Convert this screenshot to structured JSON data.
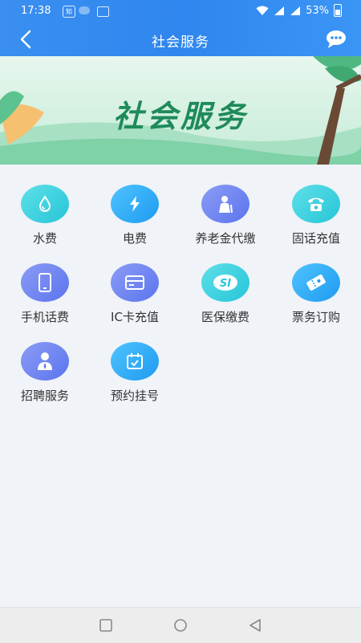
{
  "status_bar": {
    "time": "17:38",
    "notif_text": "知",
    "battery_pct": "53%"
  },
  "header": {
    "title": "社会服务",
    "back_icon": "chevron-left-icon",
    "chat_icon": "chat-bubble-icon"
  },
  "banner": {
    "title": "社会服务"
  },
  "services": [
    {
      "label": "水费",
      "icon": "water-drop-icon",
      "color": "#26c5d8"
    },
    {
      "label": "电费",
      "icon": "lightning-icon",
      "color": "#1e9bf0"
    },
    {
      "label": "养老金代缴",
      "icon": "elderly-person-icon",
      "color": "#5b74ee"
    },
    {
      "label": "固话充值",
      "icon": "telephone-icon",
      "color": "#26c5d8"
    },
    {
      "label": "手机话费",
      "icon": "mobile-phone-icon",
      "color": "#5b74ee"
    },
    {
      "label": "IC卡充值",
      "icon": "card-icon",
      "color": "#5b74ee"
    },
    {
      "label": "医保缴费",
      "icon": "insurance-badge-icon",
      "color": "#26c5d8"
    },
    {
      "label": "票务订购",
      "icon": "ticket-icon",
      "color": "#1e9bf0"
    },
    {
      "label": "招聘服务",
      "icon": "recruiter-icon",
      "color": "#5b74ee"
    },
    {
      "label": "预约挂号",
      "icon": "calendar-check-icon",
      "color": "#1e9bf0"
    }
  ],
  "nav": {
    "recent_icon": "square-icon",
    "home_icon": "circle-icon",
    "back_icon": "triangle-back-icon"
  }
}
